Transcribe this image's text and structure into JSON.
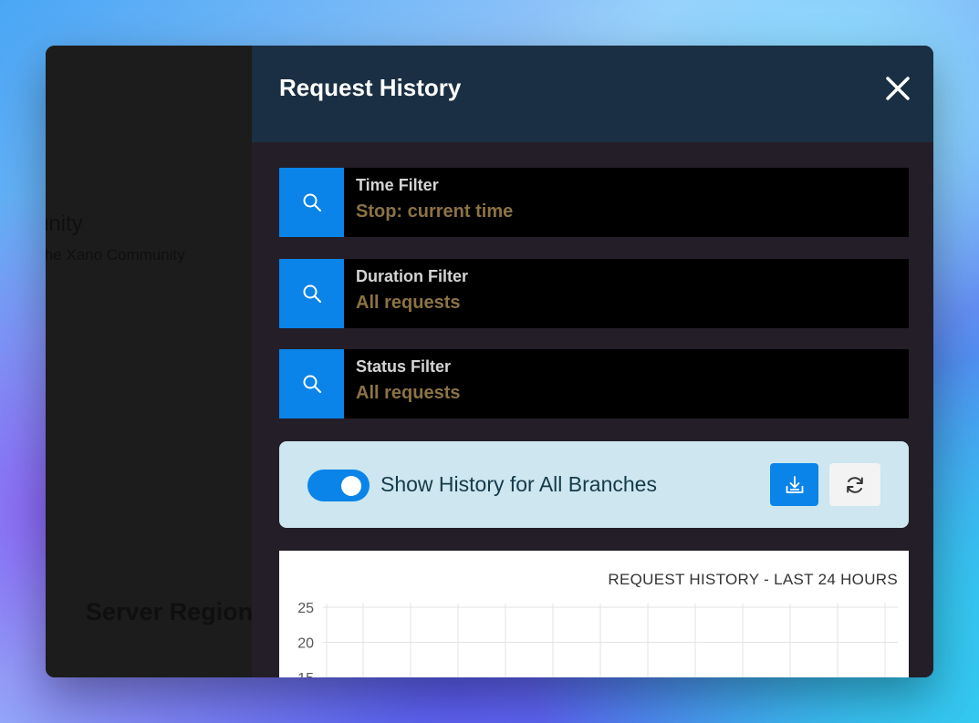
{
  "background_page": {
    "heading": "unity",
    "subtext": "the Xano Community",
    "section": "Server Region"
  },
  "drawer": {
    "title": "Request History"
  },
  "filters": [
    {
      "label": "Time Filter",
      "value": "Stop: current time",
      "icon": "search-icon"
    },
    {
      "label": "Duration Filter",
      "value": "All requests",
      "icon": "search-icon"
    },
    {
      "label": "Status Filter",
      "value": "All requests",
      "icon": "search-icon"
    }
  ],
  "branches": {
    "label": "Show History for All Branches",
    "enabled": true,
    "download_icon": "download-icon",
    "refresh_icon": "refresh-icon"
  },
  "colors": {
    "accent": "#0a84e8",
    "header": "#1a2f43",
    "filter_value": "#8c7344"
  },
  "chart_data": {
    "type": "line",
    "title": "REQUEST HISTORY - LAST 24 HOURS",
    "y_ticks": [
      25,
      20,
      15
    ],
    "ylim": [
      0,
      25
    ],
    "grid": true,
    "series": []
  }
}
